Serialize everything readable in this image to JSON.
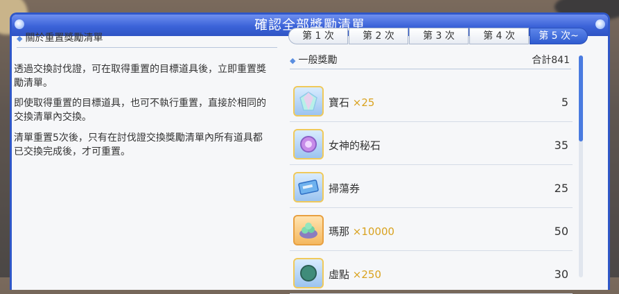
{
  "header": {
    "title": "確認全部獎勵清單"
  },
  "left": {
    "title": "關於重置獎勵清單",
    "paragraphs": [
      "透過交換討伐證，可在取得重置的目標道具後，立即重置獎勵清單。",
      "即使取得重置的目標道具，也可不執行重置，直接於相同的交換清單內交換。",
      "清單重置5次後，只有在討伐證交換獎勵清單內所有道具都已交換完成後，才可重置。"
    ]
  },
  "tabs": [
    "第 1 次",
    "第 2 次",
    "第 3 次",
    "第 4 次",
    "第 5 次~"
  ],
  "list": {
    "title": "一般獎勵",
    "total": "合計841",
    "items": [
      {
        "name": "寶石",
        "mult": "×25",
        "value": "5",
        "icon": "gem-icon"
      },
      {
        "name": "女神的秘石",
        "mult": "",
        "value": "35",
        "icon": "goddess-stone-icon"
      },
      {
        "name": "掃蕩券",
        "mult": "",
        "value": "25",
        "icon": "sweep-ticket-icon"
      },
      {
        "name": "瑪那",
        "mult": "×10000",
        "value": "50",
        "icon": "mana-icon"
      },
      {
        "name": "虛點",
        "mult": "×250",
        "value": "30",
        "icon": "item-icon"
      }
    ]
  }
}
